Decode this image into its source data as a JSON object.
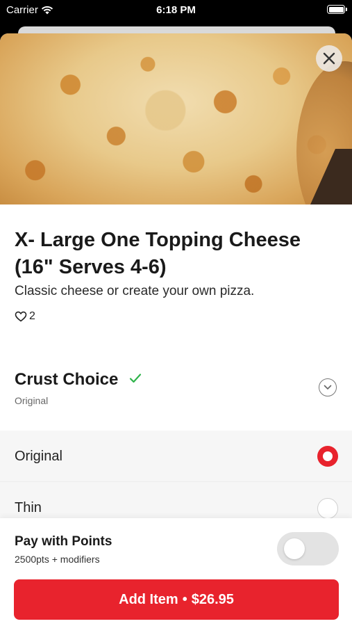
{
  "status_bar": {
    "carrier": "Carrier",
    "time": "6:18 PM",
    "icons": [
      "wifi-icon",
      "battery-icon"
    ]
  },
  "item": {
    "title": "X- Large One Topping Cheese (16\" Serves 4-6)",
    "description": "Classic cheese or create your own pizza.",
    "likes": "2",
    "image": "cheese-pizza-photo"
  },
  "crust": {
    "title": "Crust Choice",
    "selected_value": "Original",
    "options": [
      {
        "label": "Original",
        "selected": true
      },
      {
        "label": "Thin",
        "selected": false
      }
    ]
  },
  "footer": {
    "points_title": "Pay with Points",
    "points_subtitle": "2500pts + modifiers",
    "points_enabled": false,
    "add_label": "Add Item",
    "separator": "•",
    "price": "$26.95"
  },
  "colors": {
    "accent": "#e8232d",
    "check": "#2eb34a",
    "toggle_off": "#e3e3e3"
  }
}
